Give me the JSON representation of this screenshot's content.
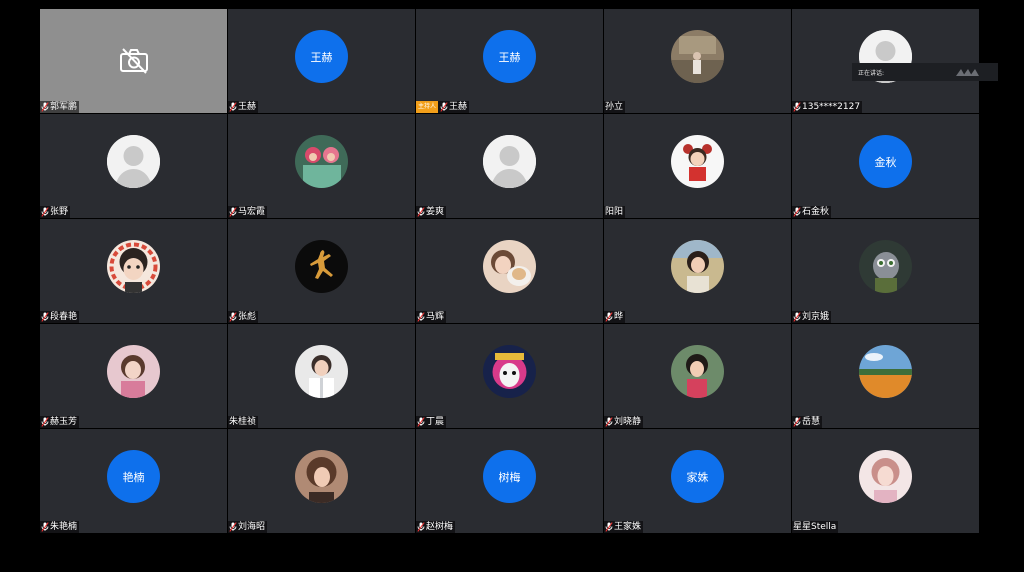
{
  "speaking_panel": {
    "label": "正在讲话:"
  },
  "participants": [
    {
      "name": "郭军鹏",
      "avatar": "camera-off"
    },
    {
      "name": "王赫",
      "avatar": "text",
      "avatar_text": "王赫"
    },
    {
      "name": "王赫",
      "avatar": "text",
      "avatar_text": "王赫",
      "host_tag": "主持人"
    },
    {
      "name": "孙立",
      "avatar": "photo",
      "photo_icon": "photo-outdoor-stairs"
    },
    {
      "name": "135****2127",
      "avatar": "default"
    },
    {
      "name": "张野",
      "avatar": "default"
    },
    {
      "name": "马宏霞",
      "avatar": "photo",
      "photo_icon": "photo-kids-costume"
    },
    {
      "name": "姜爽",
      "avatar": "default"
    },
    {
      "name": "阳阳",
      "avatar": "photo",
      "photo_icon": "photo-cartoon-girl"
    },
    {
      "name": "石金秋",
      "avatar": "text",
      "avatar_text": "金秋"
    },
    {
      "name": "段春艳",
      "avatar": "photo",
      "photo_icon": "photo-cartoon-face"
    },
    {
      "name": "张彪",
      "avatar": "photo",
      "photo_icon": "photo-jumpman-logo"
    },
    {
      "name": "马辉",
      "avatar": "photo",
      "photo_icon": "photo-girl-dog"
    },
    {
      "name": "晔",
      "avatar": "photo",
      "photo_icon": "photo-woman-outdoors"
    },
    {
      "name": "刘京娥",
      "avatar": "photo",
      "photo_icon": "photo-cartoon-animal"
    },
    {
      "name": "赫玉芳",
      "avatar": "photo",
      "photo_icon": "photo-woman-pink"
    },
    {
      "name": "朱桂祯",
      "avatar": "photo",
      "photo_icon": "photo-woman-white"
    },
    {
      "name": "丁晨",
      "avatar": "photo",
      "photo_icon": "photo-opera-mask"
    },
    {
      "name": "刘晓静",
      "avatar": "photo",
      "photo_icon": "photo-child-girl"
    },
    {
      "name": "岳慧",
      "avatar": "photo",
      "photo_icon": "photo-landscape"
    },
    {
      "name": "朱艳楠",
      "avatar": "text",
      "avatar_text": "艳楠"
    },
    {
      "name": "刘海昭",
      "avatar": "photo",
      "photo_icon": "photo-woman-hair"
    },
    {
      "name": "赵树梅",
      "avatar": "text",
      "avatar_text": "树梅"
    },
    {
      "name": "王家姝",
      "avatar": "text",
      "avatar_text": "家姝"
    },
    {
      "name": "星星Stella",
      "avatar": "photo",
      "photo_icon": "photo-woman-portrait"
    }
  ],
  "colors": {
    "tile_bg": "#2a2c31",
    "camera_off_bg": "#8f8f8f",
    "avatar_blue": "#0e70ec",
    "host_tag": "#f29f1a"
  }
}
